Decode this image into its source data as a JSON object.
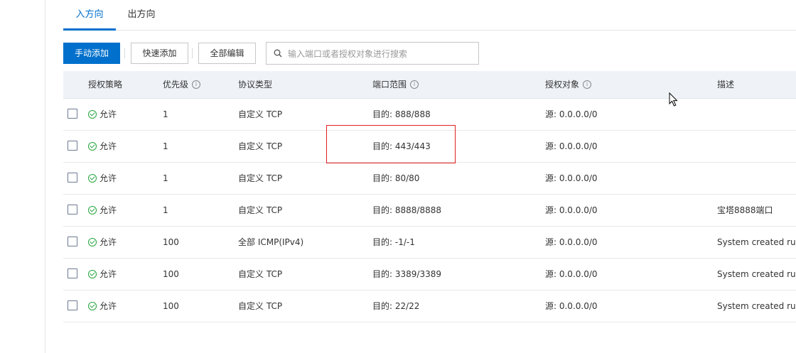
{
  "tabs": [
    {
      "label": "入方向",
      "active": true
    },
    {
      "label": "出方向",
      "active": false
    }
  ],
  "toolbar": {
    "manual_add": "手动添加",
    "quick_add": "快速添加",
    "edit_all": "全部编辑",
    "search_placeholder": "输入端口或者授权对象进行搜索"
  },
  "table": {
    "columns": [
      "授权策略",
      "优先级",
      "协议类型",
      "端口范围",
      "授权对象",
      "描述"
    ],
    "rows": [
      {
        "policy": "允许",
        "priority": "1",
        "protocol": "自定义 TCP",
        "port": "目的: 888/888",
        "source": "源: 0.0.0.0/0",
        "desc": ""
      },
      {
        "policy": "允许",
        "priority": "1",
        "protocol": "自定义 TCP",
        "port": "目的: 443/443",
        "source": "源: 0.0.0.0/0",
        "desc": ""
      },
      {
        "policy": "允许",
        "priority": "1",
        "protocol": "自定义 TCP",
        "port": "目的: 80/80",
        "source": "源: 0.0.0.0/0",
        "desc": ""
      },
      {
        "policy": "允许",
        "priority": "1",
        "protocol": "自定义 TCP",
        "port": "目的: 8888/8888",
        "source": "源: 0.0.0.0/0",
        "desc": "宝塔8888端口"
      },
      {
        "policy": "允许",
        "priority": "100",
        "protocol": "全部 ICMP(IPv4)",
        "port": "目的: -1/-1",
        "source": "源: 0.0.0.0/0",
        "desc": "System created rule."
      },
      {
        "policy": "允许",
        "priority": "100",
        "protocol": "自定义 TCP",
        "port": "目的: 3389/3389",
        "source": "源: 0.0.0.0/0",
        "desc": "System created rule."
      },
      {
        "policy": "允许",
        "priority": "100",
        "protocol": "自定义 TCP",
        "port": "目的: 22/22",
        "source": "源: 0.0.0.0/0",
        "desc": "System created rule."
      }
    ]
  },
  "colors": {
    "primary": "#0070cc",
    "allow": "#22a33a",
    "highlight": "#e02020",
    "header_bg": "#eff3f8"
  },
  "icons": {
    "search": "search-icon",
    "info": "info-icon",
    "allow": "check-circle-icon",
    "cursor": "mouse-pointer-icon"
  }
}
